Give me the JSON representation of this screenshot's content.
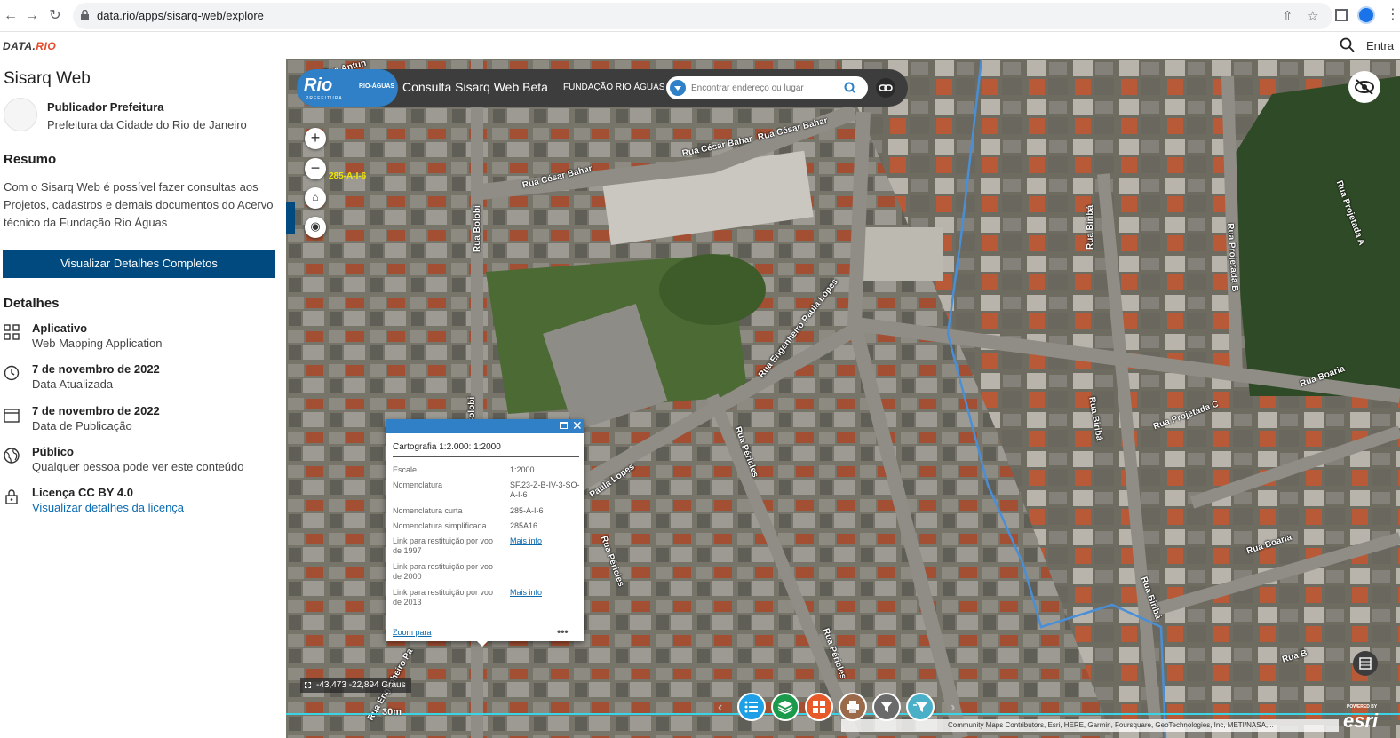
{
  "browser": {
    "url": "data.rio/apps/sisarq-web/explore"
  },
  "site": {
    "logo_data": "DATA.",
    "logo_rio": "RIO",
    "login_label": "Entra"
  },
  "left": {
    "title": "Sisarq Web",
    "publisher_name": "Publicador Prefeitura",
    "publisher_org": "Prefeitura da Cidade do Rio de Janeiro",
    "summary_title": "Resumo",
    "summary_text": "Com o Sisarq Web é possível fazer consultas aos Projetos, cadastros e demais documentos do Acervo técnico da Fundação Rio Águas",
    "details_button": "Visualizar Detalhes Completos",
    "details_title": "Detalhes",
    "details": [
      {
        "title": "Aplicativo",
        "sub": "Web Mapping Application",
        "icon": "grid-icon"
      },
      {
        "title": "7 de novembro de 2022",
        "sub": "Data Atualizada",
        "icon": "history-icon"
      },
      {
        "title": "7 de novembro de 2022",
        "sub": "Data de Publicação",
        "icon": "calendar-icon"
      },
      {
        "title": "Público",
        "sub": "Qualquer pessoa pode ver este conteúdo",
        "icon": "globe-icon"
      },
      {
        "title": "Licença CC BY 4.0",
        "sub": "Visualizar detalhes da licença",
        "icon": "lock-icon"
      }
    ]
  },
  "map": {
    "logo_rio": "Rio",
    "logo_prefeitura": "PREFEITURA",
    "logo_aguas": "RIO-ÁGUAS",
    "title": "Consulta Sisarq Web Beta",
    "subtitle": "FUNDAÇÃO RIO ÁGUAS",
    "search_placeholder": "Encontrar endereço ou lugar",
    "grid_label": "285-A-I-6",
    "coords": "-43,473 -22,894 Graus",
    "scale_label": "30m",
    "attribution": "Community Maps Contributors, Esri, HERE, Garmin, Foursquare, GeoTechnologies, Inc, METI/NASA,...",
    "esri_powered": "POWERED BY",
    "esri_logo": "esri",
    "streets": [
      "Rua César Bahar",
      "Rua César Bahar",
      "Rua César Bahar",
      "Rua Bolobi",
      "Rua Engenheiro Paula Lopes",
      "Paula Lopes",
      "Rua Péricles",
      "Rua Péricles",
      "Rua Péricles",
      "Rua Biribá",
      "Rua Biribá",
      "Rua Biribá",
      "Rua Projetada B",
      "Rua Projetada A",
      "Rua Projetada C",
      "Rua Boaria",
      "Rua Boaria",
      "Rua B",
      "Rua Engenheiro Pa",
      "Bolobi",
      "Rua Antun"
    ]
  },
  "popup": {
    "title": "Cartografia 1:2.000: 1:2000",
    "rows": [
      {
        "key": "Escale",
        "value": "1:2000"
      },
      {
        "key": "Nomenclatura",
        "value": "SF.23-Z-B-IV-3-SO-A-I-6"
      },
      {
        "key": "Nomenclatura curta",
        "value": "285-A-I-6"
      },
      {
        "key": "Nomenclatura simplificada",
        "value": "285A16"
      },
      {
        "key": "Link para restituição por voo de 1997",
        "value": "Mais info"
      },
      {
        "key": "Link para restituição por voo de 2000",
        "value": ""
      },
      {
        "key": "Link para restituição por voo de 2013",
        "value": "Mais info"
      }
    ],
    "zoom_label": "Zoom para",
    "more_label": "•••"
  },
  "colors": {
    "primary": "#004a80",
    "map_blue": "#2f80c7",
    "tool_list": "#1ea0e6",
    "tool_layers": "#1a9a4a",
    "tool_grid": "#e8592a",
    "tool_print": "#9a6a4a",
    "tool_filter": "#6a6a6a",
    "tool_filter2": "#4ab0c8"
  }
}
